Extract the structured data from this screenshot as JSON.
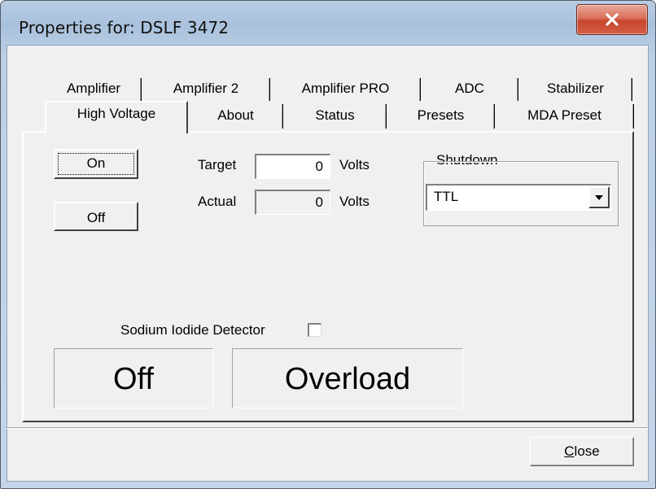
{
  "window": {
    "title": "Properties for: DSLF 3472",
    "close_glyph": "✕"
  },
  "tabs_back_row": [
    "Amplifier",
    "Amplifier 2",
    "Amplifier PRO",
    "ADC",
    "Stabilizer"
  ],
  "tabs_front_row": [
    "High Voltage",
    "About",
    "Status",
    "Presets",
    "MDA Preset"
  ],
  "selected_tab": "High Voltage",
  "hv": {
    "on_label": "On",
    "off_label": "Off",
    "target_label": "Target",
    "target_value": "0",
    "target_unit": "Volts",
    "actual_label": "Actual",
    "actual_value": "0",
    "actual_unit": "Volts"
  },
  "shutdown": {
    "title": "Shutdown",
    "selected": "TTL"
  },
  "detector": {
    "label": "Sodium Iodide Detector",
    "checked": false
  },
  "status": {
    "power": "Off",
    "overload": "Overload"
  },
  "footer": {
    "close_label": "Close"
  }
}
